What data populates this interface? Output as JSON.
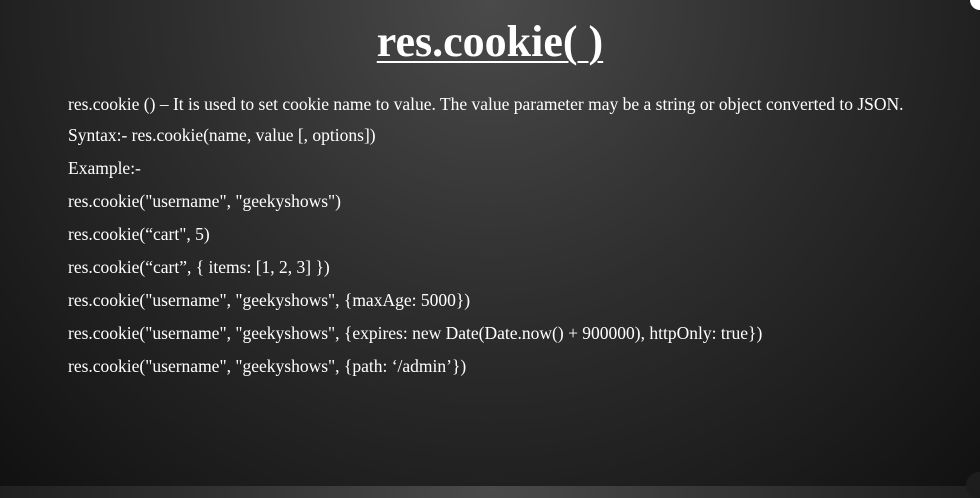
{
  "slide": {
    "title": "res.cookie( )",
    "description": "res.cookie () –  It is used to set cookie name to value. The value parameter may be a string or object converted to JSON.",
    "syntax": "Syntax:- res.cookie(name, value [, options])",
    "example_label": "Example:-",
    "examples": [
      "res.cookie(\"username\", \"geekyshows\")",
      "res.cookie(“cart\", 5)",
      "res.cookie(“cart”, { items: [1, 2, 3] })",
      "res.cookie(\"username\", \"geekyshows\", {maxAge: 5000})",
      "res.cookie(\"username\", \"geekyshows\", {expires: new Date(Date.now() + 900000), httpOnly: true})",
      "res.cookie(\"username\", \"geekyshows\", {path: ‘/admin’})"
    ]
  },
  "colors": {
    "text": "#ffffff",
    "background_center": "#4a4a4a",
    "background_edge": "#111111"
  }
}
